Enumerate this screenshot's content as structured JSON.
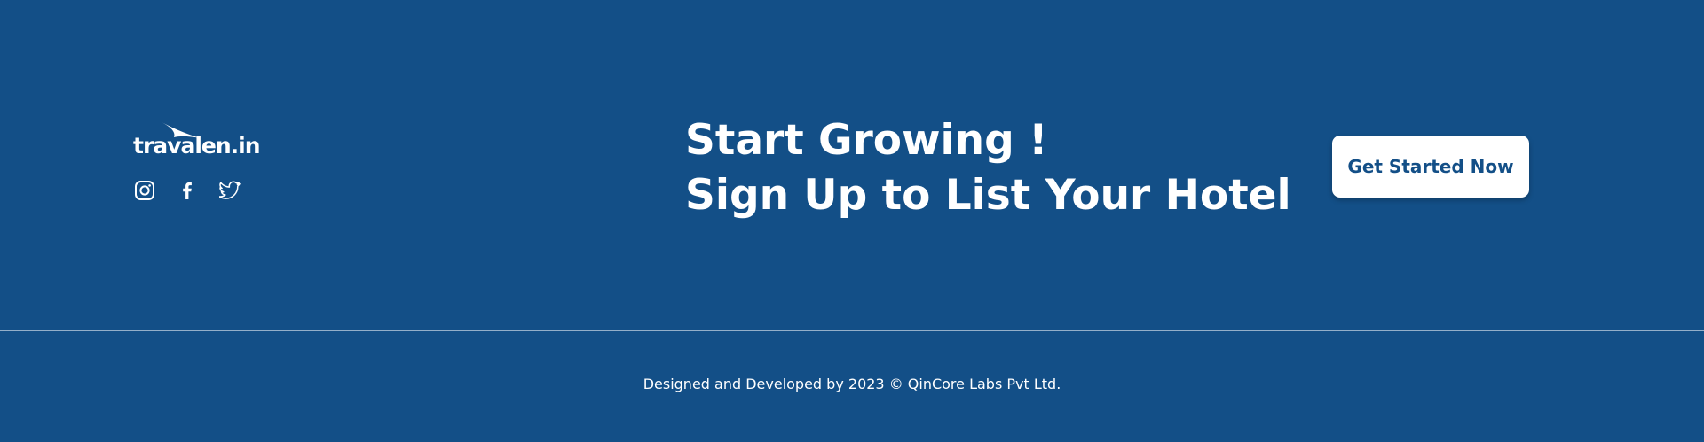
{
  "brand": {
    "logo_text": "travalen.in"
  },
  "socials": [
    {
      "icon": "instagram-icon"
    },
    {
      "icon": "facebook-icon"
    },
    {
      "icon": "twitter-icon"
    }
  ],
  "cta": {
    "headline_line1": "Start Growing !",
    "headline_line2": "Sign Up to List Your Hotel",
    "button_label": "Get Started Now"
  },
  "footer": {
    "copyright": "Designed and Developed by 2023 © QinCore Labs Pvt Ltd."
  },
  "colors": {
    "background": "#134f87",
    "button_bg": "#ffffff",
    "button_text": "#134f87",
    "text": "#ffffff"
  }
}
